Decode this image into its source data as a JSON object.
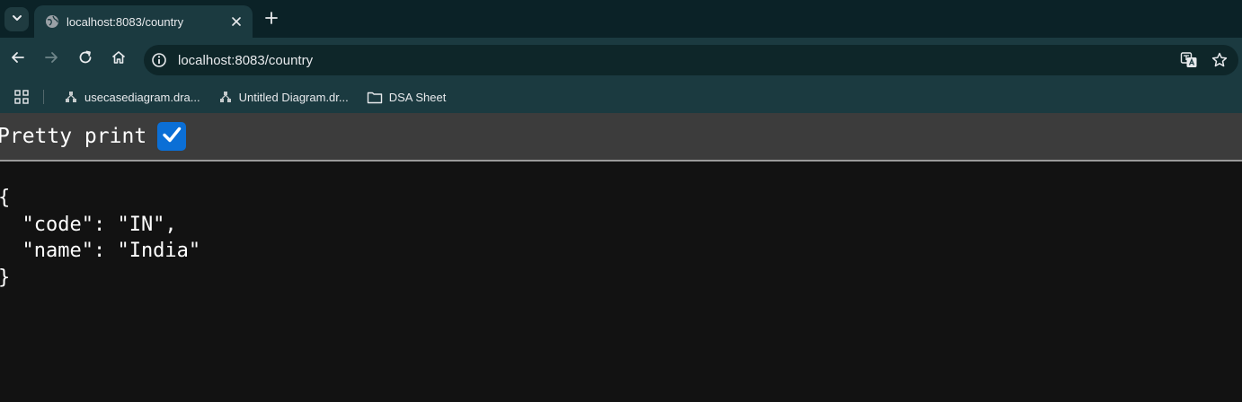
{
  "browser": {
    "tab": {
      "title": "localhost:8083/country",
      "favicon": "globe-icon"
    },
    "omnibox": {
      "url": "localhost:8083/country"
    },
    "bookmarks": [
      {
        "label": "usecasediagram.dra...",
        "icon": "drawio-icon"
      },
      {
        "label": "Untitled Diagram.dr...",
        "icon": "drawio-icon"
      },
      {
        "label": "DSA Sheet",
        "icon": "folder-icon"
      }
    ]
  },
  "viewer": {
    "pretty_print_label": "Pretty print",
    "pretty_print_checked": true,
    "json_lines": [
      "{",
      "  \"code\": \"IN\",",
      "  \"name\": \"India\"",
      "}"
    ]
  },
  "colors": {
    "accent": "#0b6fd6",
    "chrome_bg": "#1b3a40",
    "tabstrip_bg": "#0b2227"
  }
}
